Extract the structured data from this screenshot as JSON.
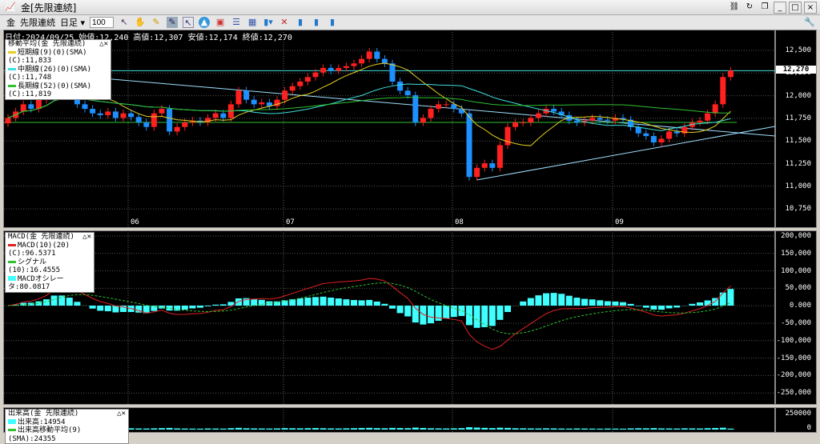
{
  "window": {
    "title": "金[先限連続]"
  },
  "toolbar": {
    "commodity": "金",
    "contract": "先限連続",
    "period": "日足",
    "count": "100"
  },
  "info": "日付:2024/09/25 始値:12,240 高値:12,307 安値:12,174 終値:12,270",
  "ma_legend": {
    "title": "移動平均(金 先限連続)",
    "short": "短期線(9)(0)(SMA)(C):11,833",
    "mid": "中期線(26)(0)(SMA)(C):11,748",
    "long": "長期線(52)(0)(SMA)(C):11,819"
  },
  "macd_legend": {
    "title": "MACD(金 先限連続)",
    "macd": "MACD(10)(20)(C):96.5371",
    "signal": "シグナル(10):16.4555",
    "osc": "MACDオシレータ:80.0817"
  },
  "vol_legend": {
    "title": "出来高(金 先限連続)",
    "vol": "出来高:14954",
    "ma": "出来高移動平均(9)(SMA):24355"
  },
  "price_axis": [
    "12,500",
    "12,250",
    "12,000",
    "11,750",
    "11,500",
    "11,250",
    "11,000",
    "10,750"
  ],
  "last_price": "12,270",
  "macd_axis": [
    "200,000",
    "150,000",
    "100,000",
    "50,000",
    "0.000",
    "-50,000",
    "-100,000",
    "-150,000",
    "-200,000",
    "-250,000"
  ],
  "vol_axis": [
    "250000",
    "0"
  ],
  "months": [
    "06",
    "07",
    "08",
    "09"
  ],
  "colors": {
    "up": "#ff2020",
    "down": "#1e90ff",
    "short": "#e8d020",
    "mid": "#40e0e0",
    "long": "#30c030",
    "macd": "#e02020",
    "signal": "#30c030",
    "osc": "#40ffff"
  },
  "chart_data": {
    "type": "candlestick",
    "closes": [
      11750,
      11820,
      11900,
      11850,
      11950,
      12050,
      12250,
      12150,
      12050,
      11900,
      11850,
      11800,
      11780,
      11820,
      11750,
      11800,
      11760,
      11700,
      11650,
      11800,
      11850,
      11600,
      11650,
      11700,
      11720,
      11700,
      11750,
      11800,
      11750,
      11900,
      12050,
      11950,
      11900,
      11920,
      11880,
      11950,
      12050,
      12100,
      12150,
      12200,
      12250,
      12300,
      12270,
      12300,
      12320,
      12350,
      12400,
      12480,
      12400,
      12350,
      12150,
      12050,
      12000,
      11700,
      11750,
      11850,
      11900,
      11900,
      11850,
      11800,
      11100,
      11200,
      11250,
      11200,
      11450,
      11650,
      11700,
      11700,
      11750,
      11800,
      11850,
      11820,
      11780,
      11720,
      11700,
      11720,
      11750,
      11730,
      11720,
      11750,
      11730,
      11650,
      11580,
      11550,
      11480,
      11520,
      11600,
      11580,
      11650,
      11700,
      11720,
      11800,
      11900,
      12200,
      12270
    ],
    "volumes": [
      22000,
      18000,
      20000,
      17000,
      19000,
      24000,
      30000,
      21000,
      18000,
      16000,
      15000,
      17000,
      14000,
      16000,
      15000,
      18000,
      20000,
      17000,
      16000,
      19000,
      22000,
      25000,
      18000,
      16000,
      15000,
      14000,
      17000,
      16000,
      15000,
      21000,
      26000,
      20000,
      18000,
      17000,
      16000,
      18000,
      22000,
      20000,
      19000,
      21000,
      23000,
      20000,
      18000,
      17000,
      19000,
      21000,
      24000,
      26000,
      22000,
      20000,
      25000,
      23000,
      21000,
      30000,
      24000,
      20000,
      18000,
      17000,
      19000,
      22000,
      35000,
      30000,
      26000,
      22000,
      28000,
      25000,
      20000,
      19000,
      18000,
      17000,
      19000,
      18000,
      16000,
      15000,
      17000,
      16000,
      15000,
      14000,
      16000,
      15000,
      14000,
      18000,
      20000,
      19000,
      22000,
      18000,
      17000,
      16000,
      19000,
      18000,
      17000,
      21000,
      24000,
      28000,
      14954
    ]
  }
}
